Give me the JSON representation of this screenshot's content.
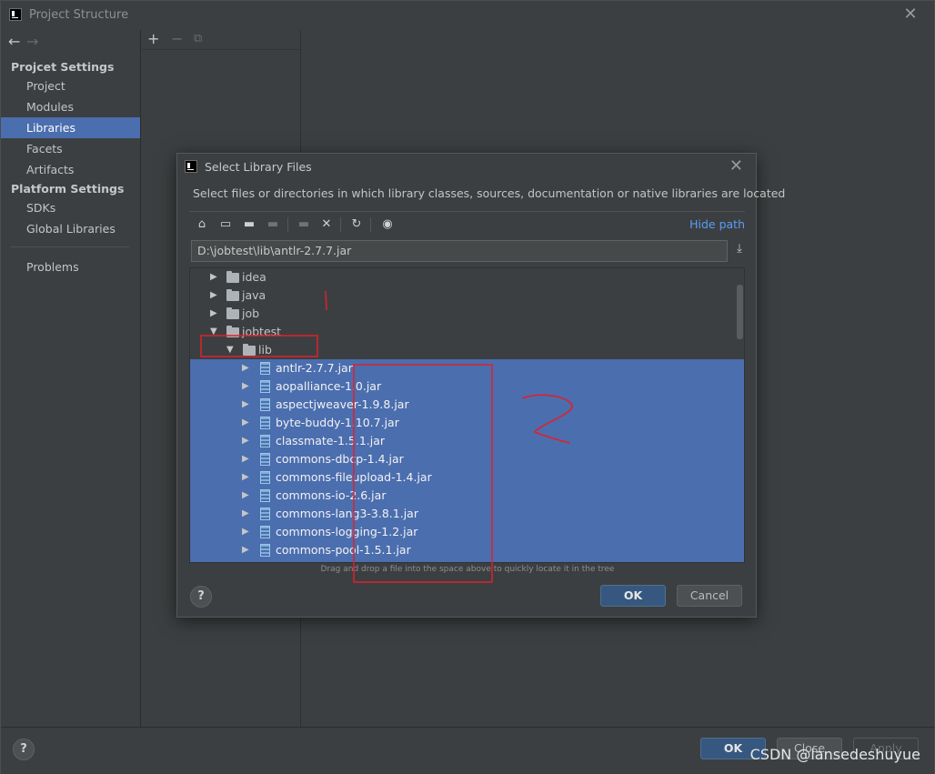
{
  "window": {
    "title": "Project Structure"
  },
  "sidebar": {
    "project_settings_title": "Projcet Settings",
    "platform_settings_title": "Platform Settings",
    "items": [
      {
        "label": "Project"
      },
      {
        "label": "Modules"
      },
      {
        "label": "Libraries",
        "selected": true
      },
      {
        "label": "Facets"
      },
      {
        "label": "Artifacts"
      },
      {
        "label": "SDKs"
      },
      {
        "label": "Global Libraries"
      },
      {
        "label": "Problems"
      }
    ]
  },
  "main_buttons": {
    "ok": "OK",
    "close": "Close",
    "apply": "Apply",
    "help": "?"
  },
  "dialog": {
    "title": "Select Library Files",
    "description": "Select files or directories in which library classes, sources, documentation or native libraries are located",
    "hide_path": "Hide path",
    "path": "D:\\jobtest\\lib\\antlr-2.7.7.jar",
    "drag_hint": "Drag and drop a file into the space above to quickly locate it in the tree",
    "ok": "OK",
    "cancel": "Cancel",
    "help": "?",
    "toolbar_icons": [
      "home-icon",
      "desktop-icon",
      "new-folder-icon",
      "folder-icon",
      "module-folder-icon",
      "delete-icon",
      "refresh-icon",
      "show-hidden-icon"
    ],
    "tree": [
      {
        "label": "idea",
        "type": "folder",
        "expanded": false
      },
      {
        "label": "java",
        "type": "folder",
        "expanded": false
      },
      {
        "label": "job",
        "type": "folder",
        "expanded": false
      },
      {
        "label": "jobtest",
        "type": "folder",
        "expanded": true
      },
      {
        "label": "lib",
        "type": "folder",
        "expanded": true
      },
      {
        "label": "antlr-2.7.7.jar",
        "type": "jar",
        "selected": true
      },
      {
        "label": "aopalliance-1.0.jar",
        "type": "jar",
        "selected": true
      },
      {
        "label": "aspectjweaver-1.9.8.jar",
        "type": "jar",
        "selected": true
      },
      {
        "label": "byte-buddy-1.10.7.jar",
        "type": "jar",
        "selected": true
      },
      {
        "label": "classmate-1.5.1.jar",
        "type": "jar",
        "selected": true
      },
      {
        "label": "commons-dbcp-1.4.jar",
        "type": "jar",
        "selected": true
      },
      {
        "label": "commons-fileupload-1.4.jar",
        "type": "jar",
        "selected": true
      },
      {
        "label": "commons-io-2.6.jar",
        "type": "jar",
        "selected": true
      },
      {
        "label": "commons-lang3-3.8.1.jar",
        "type": "jar",
        "selected": true
      },
      {
        "label": "commons-logging-1.2.jar",
        "type": "jar",
        "selected": true
      },
      {
        "label": "commons-pool-1.5.1.jar",
        "type": "jar",
        "selected": true
      }
    ]
  },
  "watermark": "CSDN @lansedeshuyue",
  "colors": {
    "selection": "#4b6eaf",
    "link": "#589df6",
    "annotation": "#e0202a"
  }
}
